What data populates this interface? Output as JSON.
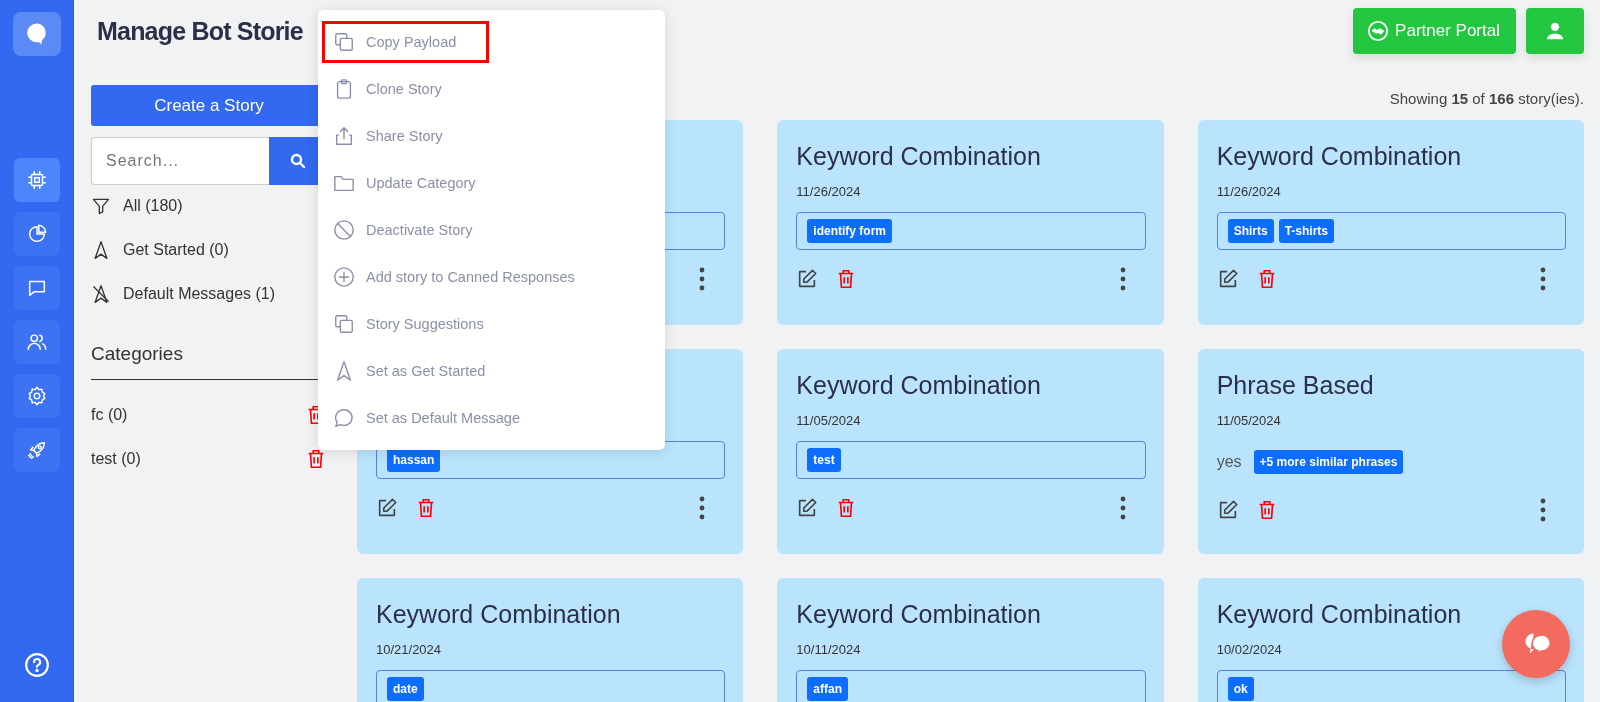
{
  "sidebar": {
    "nav_items": [
      {
        "kind": "chip",
        "selected": true
      },
      {
        "kind": "pie",
        "selected": false
      },
      {
        "kind": "chat",
        "selected": false
      },
      {
        "kind": "users",
        "selected": false
      },
      {
        "kind": "gear",
        "selected": false
      },
      {
        "kind": "rocket",
        "selected": false
      }
    ]
  },
  "header": {
    "title": "Manage Bot Storie",
    "partner_button": "Partner Portal"
  },
  "left_panel": {
    "create_button": "Create a Story",
    "search": {
      "placeholder": "Search..."
    },
    "filters": [
      {
        "kind": "all",
        "label": "All (180)"
      },
      {
        "kind": "get_started",
        "label": "Get Started (0)"
      },
      {
        "kind": "default",
        "label": "Default Messages (1)"
      }
    ],
    "categories_title": "Categories",
    "categories": [
      {
        "label": "fc (0)"
      },
      {
        "label": "test (0)"
      }
    ]
  },
  "summary": "Showing **15** of **166** story(ies).",
  "cards": [
    {
      "kind": "keyword"
    },
    {
      "kind": "keyword",
      "title": "Keyword Combination",
      "date": "11/26/2024",
      "tags": [
        "identify form"
      ]
    },
    {
      "kind": "keyword",
      "title": "Keyword Combination",
      "date": "11/26/2024",
      "tags": [
        "Shirts",
        "T-shirts"
      ]
    },
    {
      "kind": "keyword",
      "tags": [
        "hassan"
      ]
    },
    {
      "kind": "keyword",
      "title": "Keyword Combination",
      "date": "11/05/2024",
      "tags": [
        "test"
      ]
    },
    {
      "kind": "phrase",
      "title": "Phrase Based",
      "date": "11/05/2024",
      "phrase": "yes",
      "more": "+5 more similar phrases"
    },
    {
      "kind": "keyword",
      "title": "Keyword Combination",
      "date": "10/21/2024",
      "tags": [
        "date"
      ]
    },
    {
      "kind": "keyword",
      "title": "Keyword Combination",
      "date": "10/11/2024",
      "tags": [
        "affan"
      ]
    },
    {
      "kind": "keyword",
      "title": "Keyword Combination",
      "date": "10/02/2024",
      "tags": [
        "ok"
      ]
    }
  ],
  "context_menu": {
    "items": [
      {
        "kind": "copy",
        "label": "Copy Payload",
        "highlighted": true
      },
      {
        "kind": "clipboard",
        "label": "Clone Story",
        "highlighted": false
      },
      {
        "kind": "share",
        "label": "Share Story",
        "highlighted": false
      },
      {
        "kind": "folder",
        "label": "Update Category",
        "highlighted": false
      },
      {
        "kind": "ban",
        "label": "Deactivate Story",
        "highlighted": false
      },
      {
        "kind": "plus",
        "label": "Add story to Canned Responses",
        "highlighted": false
      },
      {
        "kind": "copy",
        "label": "Story Suggestions",
        "highlighted": false
      },
      {
        "kind": "navigate",
        "label": "Set as Get Started",
        "highlighted": false
      },
      {
        "kind": "message",
        "label": "Set as Default Message",
        "highlighted": false
      }
    ]
  }
}
